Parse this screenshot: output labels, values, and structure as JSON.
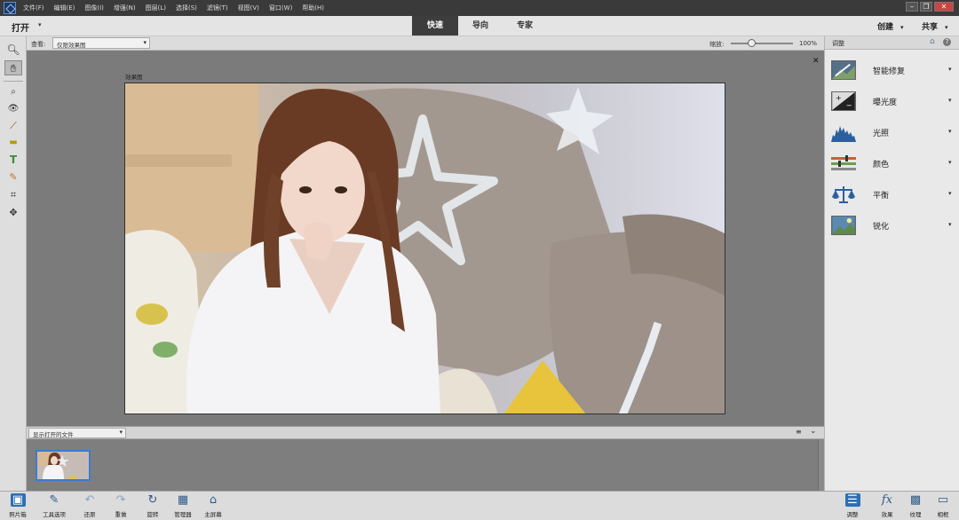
{
  "menubar": {
    "items": [
      "文件(F)",
      "编辑(E)",
      "图像(I)",
      "增强(N)",
      "图层(L)",
      "选择(S)",
      "滤镜(T)",
      "视图(V)",
      "窗口(W)",
      "帮助(H)"
    ],
    "window_buttons": [
      "–",
      "❐",
      "✕"
    ]
  },
  "modebar": {
    "open_label": "打开",
    "tabs": [
      "快速",
      "导向",
      "专家"
    ],
    "active_tab": "快速",
    "create_label": "创建",
    "share_label": "共享"
  },
  "options": {
    "view_label": "查看:",
    "view_value": "仅限效果图",
    "zoom_label": "缩放:",
    "zoom_value": "100%",
    "zoom_level": 0.33
  },
  "document": {
    "title": "效果图"
  },
  "bin": {
    "select_value": "显示打开的文件"
  },
  "panel": {
    "title": "调整",
    "adjustments": [
      "智能修复",
      "曝光度",
      "光照",
      "颜色",
      "平衡",
      "锐化"
    ]
  },
  "taskbar": {
    "left": [
      "照片箱",
      "工具选项",
      "还原",
      "重做",
      "旋转",
      "管理器",
      "主屏幕"
    ],
    "right": [
      "调整",
      "效果",
      "纹理",
      "相框"
    ],
    "active_left": "照片箱",
    "active_right": "调整"
  },
  "colors": {
    "accent": "#2c6fb6",
    "dark_chrome": "#3a3a3a",
    "canvas_bg": "#7b7b7b"
  }
}
